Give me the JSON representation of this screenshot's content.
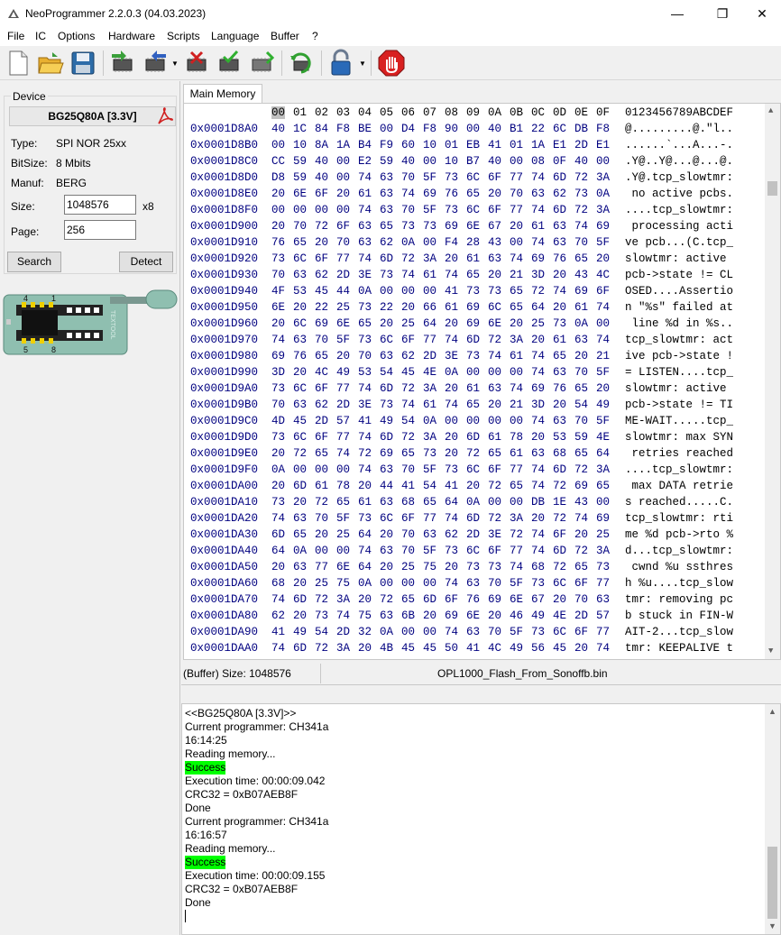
{
  "window": {
    "title": "NeoProgrammer 2.2.0.3 (04.03.2023)",
    "minimize": "—",
    "maximize": "❐",
    "close": "✕"
  },
  "menu": [
    "File",
    "IC",
    "Options",
    "Hardware",
    "Scripts",
    "Language",
    "Buffer",
    "?"
  ],
  "toolbar": {
    "icons": [
      "new-file-icon",
      "open-folder-icon",
      "save-icon",
      "read-chip-icon",
      "write-chip-icon",
      "erase-chip-icon",
      "verify-chip-icon",
      "blank-check-icon",
      "auto-icon",
      "lock-icon",
      "stop-icon"
    ]
  },
  "device": {
    "group_label": "Device",
    "name": "BG25Q80A [3.3V]",
    "type_label": "Type:",
    "type_value": "SPI NOR  25xx",
    "bitsize_label": "BitSize:",
    "bitsize_value": "8 Mbits",
    "manuf_label": "Manuf:",
    "manuf_value": "BERG",
    "size_label": "Size:",
    "size_value": "1048576",
    "size_multiplier": "x8",
    "page_label": "Page:",
    "page_value": "256",
    "search_button": "Search",
    "detect_button": "Detect"
  },
  "socket": {
    "pin1": "1",
    "pin4": "4",
    "pin5": "5",
    "pin8": "8",
    "brand": "TEXTOOL"
  },
  "tabs": [
    "Main Memory"
  ],
  "hex": {
    "columns": [
      "00",
      "01",
      "02",
      "03",
      "04",
      "05",
      "06",
      "07",
      "08",
      "09",
      "0A",
      "0B",
      "0C",
      "0D",
      "0E",
      "0F"
    ],
    "ascii_header": "0123456789ABCDEF",
    "rows": [
      {
        "addr": "0x0001D8A0",
        "bytes": "40 1C 84 F8 BE 00 D4 F8 90 00 40 B1 22 6C DB F8",
        "ascii": "@.........@.\"l.."
      },
      {
        "addr": "0x0001D8B0",
        "bytes": "00 10 8A 1A B4 F9 60 10 01 EB 41 01 1A E1 2D E1",
        "ascii": "......`...A...-."
      },
      {
        "addr": "0x0001D8C0",
        "bytes": "CC 59 40 00 E2 59 40 00 10 B7 40 00 08 0F 40 00",
        "ascii": ".Y@..Y@...@...@."
      },
      {
        "addr": "0x0001D8D0",
        "bytes": "D8 59 40 00 74 63 70 5F 73 6C 6F 77 74 6D 72 3A",
        "ascii": ".Y@.tcp_slowtmr:"
      },
      {
        "addr": "0x0001D8E0",
        "bytes": "20 6E 6F 20 61 63 74 69 76 65 20 70 63 62 73 0A",
        "ascii": " no active pcbs."
      },
      {
        "addr": "0x0001D8F0",
        "bytes": "00 00 00 00 74 63 70 5F 73 6C 6F 77 74 6D 72 3A",
        "ascii": "....tcp_slowtmr:"
      },
      {
        "addr": "0x0001D900",
        "bytes": "20 70 72 6F 63 65 73 73 69 6E 67 20 61 63 74 69",
        "ascii": " processing acti"
      },
      {
        "addr": "0x0001D910",
        "bytes": "76 65 20 70 63 62 0A 00 F4 28 43 00 74 63 70 5F",
        "ascii": "ve pcb...(C.tcp_"
      },
      {
        "addr": "0x0001D920",
        "bytes": "73 6C 6F 77 74 6D 72 3A 20 61 63 74 69 76 65 20",
        "ascii": "slowtmr: active "
      },
      {
        "addr": "0x0001D930",
        "bytes": "70 63 62 2D 3E 73 74 61 74 65 20 21 3D 20 43 4C",
        "ascii": "pcb->state != CL"
      },
      {
        "addr": "0x0001D940",
        "bytes": "4F 53 45 44 0A 00 00 00 41 73 73 65 72 74 69 6F",
        "ascii": "OSED....Assertio"
      },
      {
        "addr": "0x0001D950",
        "bytes": "6E 20 22 25 73 22 20 66 61 69 6C 65 64 20 61 74",
        "ascii": "n \"%s\" failed at"
      },
      {
        "addr": "0x0001D960",
        "bytes": "20 6C 69 6E 65 20 25 64 20 69 6E 20 25 73 0A 00",
        "ascii": " line %d in %s.."
      },
      {
        "addr": "0x0001D970",
        "bytes": "74 63 70 5F 73 6C 6F 77 74 6D 72 3A 20 61 63 74",
        "ascii": "tcp_slowtmr: act"
      },
      {
        "addr": "0x0001D980",
        "bytes": "69 76 65 20 70 63 62 2D 3E 73 74 61 74 65 20 21",
        "ascii": "ive pcb->state !"
      },
      {
        "addr": "0x0001D990",
        "bytes": "3D 20 4C 49 53 54 45 4E 0A 00 00 00 74 63 70 5F",
        "ascii": "= LISTEN....tcp_"
      },
      {
        "addr": "0x0001D9A0",
        "bytes": "73 6C 6F 77 74 6D 72 3A 20 61 63 74 69 76 65 20",
        "ascii": "slowtmr: active "
      },
      {
        "addr": "0x0001D9B0",
        "bytes": "70 63 62 2D 3E 73 74 61 74 65 20 21 3D 20 54 49",
        "ascii": "pcb->state != TI"
      },
      {
        "addr": "0x0001D9C0",
        "bytes": "4D 45 2D 57 41 49 54 0A 00 00 00 00 74 63 70 5F",
        "ascii": "ME-WAIT.....tcp_"
      },
      {
        "addr": "0x0001D9D0",
        "bytes": "73 6C 6F 77 74 6D 72 3A 20 6D 61 78 20 53 59 4E",
        "ascii": "slowtmr: max SYN"
      },
      {
        "addr": "0x0001D9E0",
        "bytes": "20 72 65 74 72 69 65 73 20 72 65 61 63 68 65 64",
        "ascii": " retries reached"
      },
      {
        "addr": "0x0001D9F0",
        "bytes": "0A 00 00 00 74 63 70 5F 73 6C 6F 77 74 6D 72 3A",
        "ascii": "....tcp_slowtmr:"
      },
      {
        "addr": "0x0001DA00",
        "bytes": "20 6D 61 78 20 44 41 54 41 20 72 65 74 72 69 65",
        "ascii": " max DATA retrie"
      },
      {
        "addr": "0x0001DA10",
        "bytes": "73 20 72 65 61 63 68 65 64 0A 00 00 DB 1E 43 00",
        "ascii": "s reached.....C."
      },
      {
        "addr": "0x0001DA20",
        "bytes": "74 63 70 5F 73 6C 6F 77 74 6D 72 3A 20 72 74 69",
        "ascii": "tcp_slowtmr: rti"
      },
      {
        "addr": "0x0001DA30",
        "bytes": "6D 65 20 25 64 20 70 63 62 2D 3E 72 74 6F 20 25",
        "ascii": "me %d pcb->rto %"
      },
      {
        "addr": "0x0001DA40",
        "bytes": "64 0A 00 00 74 63 70 5F 73 6C 6F 77 74 6D 72 3A",
        "ascii": "d...tcp_slowtmr:"
      },
      {
        "addr": "0x0001DA50",
        "bytes": "20 63 77 6E 64 20 25 75 20 73 73 74 68 72 65 73",
        "ascii": " cwnd %u ssthres"
      },
      {
        "addr": "0x0001DA60",
        "bytes": "68 20 25 75 0A 00 00 00 74 63 70 5F 73 6C 6F 77",
        "ascii": "h %u....tcp_slow"
      },
      {
        "addr": "0x0001DA70",
        "bytes": "74 6D 72 3A 20 72 65 6D 6F 76 69 6E 67 20 70 63",
        "ascii": "tmr: removing pc"
      },
      {
        "addr": "0x0001DA80",
        "bytes": "62 20 73 74 75 63 6B 20 69 6E 20 46 49 4E 2D 57",
        "ascii": "b stuck in FIN-W"
      },
      {
        "addr": "0x0001DA90",
        "bytes": "41 49 54 2D 32 0A 00 00 74 63 70 5F 73 6C 6F 77",
        "ascii": "AIT-2...tcp_slow"
      },
      {
        "addr": "0x0001DAA0",
        "bytes": "74 6D 72 3A 20 4B 45 45 50 41 4C 49 56 45 20 74",
        "ascii": "tmr: KEEPALIVE t"
      }
    ]
  },
  "status": {
    "buffer_size": "(Buffer) Size: 1048576",
    "filename": "OPL1000_Flash_From_Sonoffb.bin"
  },
  "log": [
    {
      "text": "<<BG25Q80A [3.3V]>>",
      "success": false
    },
    {
      "text": "Current programmer: CH341a",
      "success": false
    },
    {
      "text": "16:14:25",
      "success": false
    },
    {
      "text": "Reading memory...",
      "success": false
    },
    {
      "text": "Success",
      "success": true
    },
    {
      "text": "Execution time: 00:00:09.042",
      "success": false
    },
    {
      "text": "CRC32 = 0xB07AEB8F",
      "success": false
    },
    {
      "text": "Done",
      "success": false
    },
    {
      "text": "Current programmer: CH341a",
      "success": false
    },
    {
      "text": "16:16:57",
      "success": false
    },
    {
      "text": "Reading memory...",
      "success": false
    },
    {
      "text": "Success",
      "success": true
    },
    {
      "text": "Execution time: 00:00:09.155",
      "success": false
    },
    {
      "text": "CRC32 = 0xB07AEB8F",
      "success": false
    },
    {
      "text": "Done",
      "success": false
    }
  ]
}
